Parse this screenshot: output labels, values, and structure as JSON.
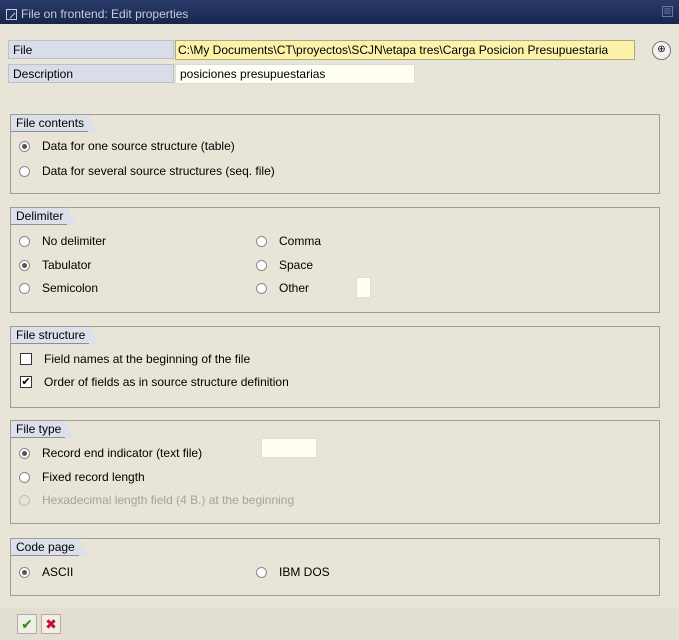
{
  "window": {
    "title": "File on frontend: Edit properties",
    "close_glyph": "⊠"
  },
  "fields": {
    "file_label": "File",
    "file_value": "C:\\My Documents\\CT\\proyectos\\SCJN\\etapa tres\\Carga Posicion Presupuestaria",
    "description_label": "Description",
    "description_value": "posiciones presupuestarias"
  },
  "file_contents": {
    "title": "File contents",
    "options": [
      {
        "label": "Data for one source structure (table)",
        "selected": true
      },
      {
        "label": "Data for several source structures (seq. file)",
        "selected": false
      }
    ]
  },
  "delimiter": {
    "title": "Delimiter",
    "options": [
      {
        "label": "No delimiter",
        "selected": false
      },
      {
        "label": "Tabulator",
        "selected": true
      },
      {
        "label": "Semicolon",
        "selected": false
      },
      {
        "label": "Comma",
        "selected": false
      },
      {
        "label": "Space",
        "selected": false
      },
      {
        "label": "Other",
        "selected": false
      }
    ],
    "other_value": ""
  },
  "file_structure": {
    "title": "File structure",
    "options": [
      {
        "label": "Field names at the beginning of the file",
        "checked": false
      },
      {
        "label": "Order of fields as in source structure definition",
        "checked": true
      }
    ]
  },
  "file_type": {
    "title": "File type",
    "options": [
      {
        "label": "Record end indicator (text file)",
        "selected": true
      },
      {
        "label": "Fixed record length",
        "selected": false
      },
      {
        "label": "Hexadecimal length field (4 B.) at the beginning",
        "selected": false,
        "disabled": true
      }
    ],
    "record_length_value": ""
  },
  "code_page": {
    "title": "Code page",
    "options": [
      {
        "label": "ASCII",
        "selected": true
      },
      {
        "label": "IBM DOS",
        "selected": false
      }
    ]
  },
  "footer": {
    "confirm_icon": "check-icon",
    "cancel_icon": "cancel-x-icon",
    "confirm_color": "#2e8b1e",
    "cancel_color": "#c8102e"
  }
}
